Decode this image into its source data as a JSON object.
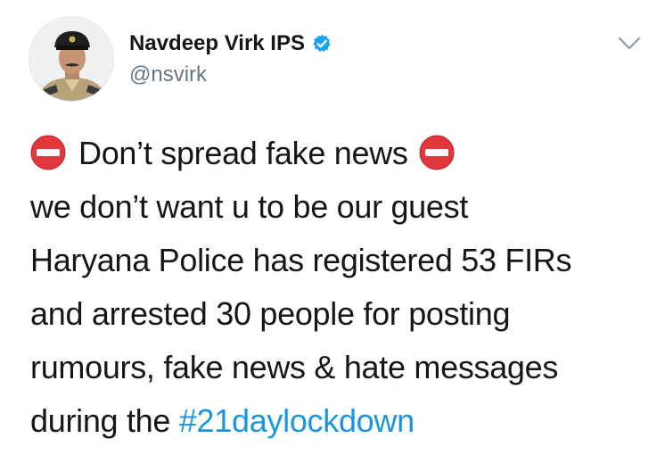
{
  "author": {
    "display_name": "Navdeep Virk IPS",
    "handle": "@nsvirk",
    "verified": true,
    "avatar_icon": "police-officer-avatar"
  },
  "tweet": {
    "line1_text": "Don’t spread fake news",
    "line1_emoji": "no-entry-icon",
    "line2": "we don’t want u to be our guest",
    "line3": "Haryana Police has registered 53 FIRs",
    "line4": "and arrested 30 people for posting",
    "line5": "rumours, fake news & hate messages",
    "line6_prefix": "during the ",
    "hashtag": "#21daylockdown"
  },
  "colors": {
    "verified_badge": "#1da1f2",
    "link": "#1b95e0",
    "secondary_text": "#657786",
    "no_entry_red": "#e0363c"
  }
}
